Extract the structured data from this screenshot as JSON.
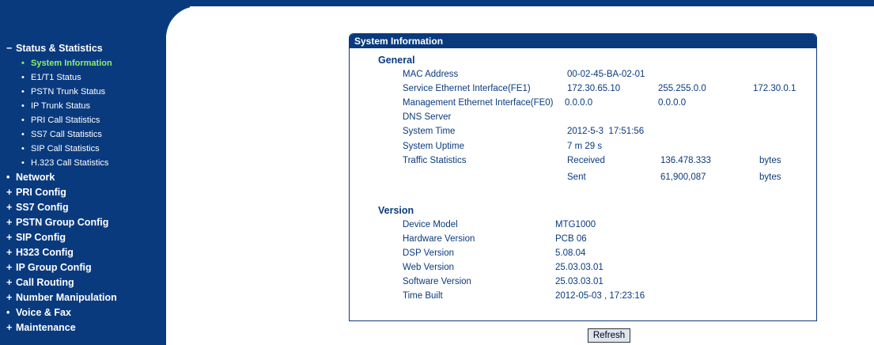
{
  "sidebar": {
    "status_section": "Status & Statistics",
    "status_items": [
      "System Information",
      "E1/T1 Status",
      "PSTN Trunk Status",
      "IP Trunk Status",
      "PRI Call Statistics",
      "SS7 Call Statistics",
      "SIP Call Statistics",
      "H.323 Call Statistics"
    ],
    "sections": [
      "Network",
      "PRI Config",
      "SS7 Config",
      "PSTN Group Config",
      "SIP Config",
      "H323 Config",
      "IP Group Config",
      "Call Routing",
      "Number Manipulation",
      "Voice & Fax",
      "Maintenance"
    ],
    "expanded_symbol": "−",
    "collapsed_symbol": "+",
    "bullet": "•",
    "network_symbol": "•",
    "voice_symbol": "•"
  },
  "panel": {
    "title": "System Information",
    "general": {
      "heading": "General",
      "mac_label": "MAC Address",
      "mac": "00-02-45-BA-02-01",
      "fe1_label": "Service Ethernet Interface(FE1)",
      "fe1_ip": "172.30.65.10",
      "fe1_mask": "255.255.0.0",
      "fe1_gw": "172.30.0.1",
      "fe0_label": "Management Ethernet Interface(FE0)",
      "fe0_ip": "0.0.0.0",
      "fe0_mask": "0.0.0.0",
      "dns_label": "DNS Server",
      "time_label": "System Time",
      "time": "2012-5-3  17:51:56",
      "uptime_label": "System Uptime",
      "uptime": "7 m 29 s",
      "traffic_label": "Traffic Statistics",
      "received_label": "Received",
      "received": "136.478.333",
      "sent_label": "Sent",
      "sent": "61,900,087",
      "unit": "bytes"
    },
    "version": {
      "heading": "Version",
      "model_label": "Device Model",
      "model": "MTG1000",
      "hw_label": "Hardware Version",
      "hw": "PCB 06",
      "dsp_label": "DSP Version",
      "dsp": "5.08.04",
      "web_label": "Web Version",
      "web": "25.03.03.01",
      "sw_label": "Software Version",
      "sw": "25.03.03.01",
      "built_label": "Time Built",
      "built": "2012-05-03 , 17:23:16"
    }
  },
  "refresh_label": "Refresh"
}
